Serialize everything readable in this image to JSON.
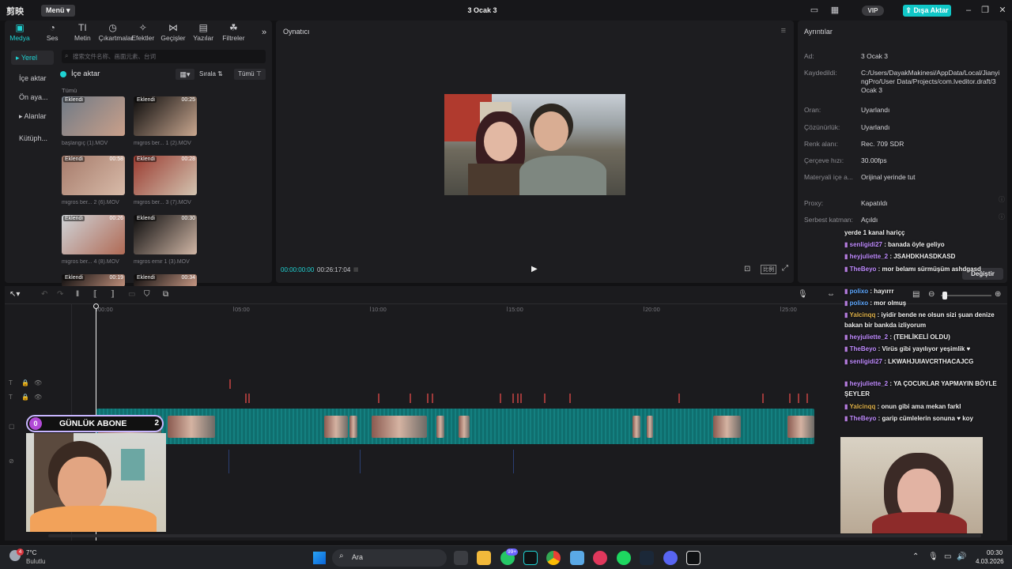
{
  "titlebar": {
    "logo": "剪映",
    "menu_label": "Menü",
    "project_title": "3 Ocak 3",
    "vip_label": "VIP",
    "export_label": "Dışa Aktar"
  },
  "media_toolbar": [
    {
      "label": "Medya",
      "icon": "media-icon",
      "active": true
    },
    {
      "label": "Ses",
      "icon": "audio-icon"
    },
    {
      "label": "Metin",
      "icon": "text-icon"
    },
    {
      "label": "Çıkartmalar",
      "icon": "sticker-icon"
    },
    {
      "label": "Efektler",
      "icon": "effects-icon"
    },
    {
      "label": "Geçişler",
      "icon": "transition-icon"
    },
    {
      "label": "Yazılar",
      "icon": "caption-icon"
    },
    {
      "label": "Filtreler",
      "icon": "filter-icon"
    }
  ],
  "media_sidebar": [
    "Yerel",
    "İçe aktar",
    "Ön aya...",
    "Alanlar",
    "Kütüph..."
  ],
  "media": {
    "search_placeholder": "搜索文件名称、画面元素、台词",
    "import_label": "İçe aktar",
    "sort_label": "Sırala",
    "filter_label": "Tümü",
    "section_label": "Tümü",
    "items": [
      {
        "badge": "Eklendi",
        "duration": "",
        "name": "başlangıç (1).MOV"
      },
      {
        "badge": "Eklendi",
        "duration": "00:25",
        "name": "migros ber... 1 (2).MOV"
      },
      {
        "badge": "Eklendi",
        "duration": "00:58",
        "name": "migros ber... 2 (6).MOV"
      },
      {
        "badge": "Eklendi",
        "duration": "00:28",
        "name": "migros ber... 3 (7).MOV"
      },
      {
        "badge": "Eklendi",
        "duration": "00:26",
        "name": "migros ber... 4 (8).MOV"
      },
      {
        "badge": "Eklendi",
        "duration": "00:30",
        "name": "migros emir 1 (3).MOV"
      },
      {
        "badge": "Eklendi",
        "duration": "00:19",
        "name": ""
      },
      {
        "badge": "Eklendi",
        "duration": "00:34",
        "name": ""
      }
    ]
  },
  "player": {
    "title": "Oynatıcı",
    "current_time": "00:00:00:00",
    "total_time": "00:26:17:04",
    "ratio_label": "比例"
  },
  "details": {
    "title": "Ayrıntılar",
    "rows": [
      {
        "label": "Ad:",
        "value": "3 Ocak 3"
      },
      {
        "label": "Kaydedildi:",
        "value": "C:/Users/DayakMakinesi/AppData/Local/JianyingPro/User Data/Projects/com.lveditor.draft/3 Ocak 3"
      },
      {
        "label": "Oran:",
        "value": "Uyarlandı"
      },
      {
        "label": "Çözünürlük:",
        "value": "Uyarlandı"
      },
      {
        "label": "Renk alanı:",
        "value": "Rec. 709 SDR"
      },
      {
        "label": "Çerçeve hızı:",
        "value": "30.00fps"
      },
      {
        "label": "Materyali içe a...",
        "value": "Orijinal yerinde tut"
      },
      {
        "label": "Proxy:",
        "value": "Kapatıldı"
      },
      {
        "label": "Serbest katman:",
        "value": "Açıldı"
      }
    ],
    "change_button": "Değiştir"
  },
  "timeline": {
    "ruler": [
      "00:00",
      "05:00",
      "10:00",
      "15:00",
      "20:00",
      "25:00"
    ]
  },
  "overlay": {
    "sub_count": "0",
    "sub_label": "GÜNLÜK ABONE",
    "sub_goal": "2"
  },
  "chat": [
    {
      "user": "",
      "text": "yerde 1 kanal hariçç"
    },
    {
      "user": "senligidi27",
      "text": ": banada öyle geliyo"
    },
    {
      "user": "heyjuliette_2",
      "text": ": JSAHDKHASDKASD"
    },
    {
      "user": "TheBeyo",
      "text": ": mor belamı sürmüşüm ashdgasd"
    },
    {
      "user": "polixo",
      "text": ": hayırrr"
    },
    {
      "user": "polixo",
      "text": ": mor olmuş"
    },
    {
      "user": "Yalcinqq",
      "text": ": iyidir bende ne olsun sizi şuan denize bakan bir bankda izliyorum"
    },
    {
      "user": "heyjuliette_2",
      "text": ": (TEHLİKELİ OLDU)"
    },
    {
      "user": "TheBeyo",
      "text": ": Virüs gibi yayılıyor yeşimlik ♥"
    },
    {
      "user": "senligidi27",
      "text": ": LKWAHJUIAVCRTHACAJCG"
    },
    {
      "user": "heyjuliette_2",
      "text": ": YA ÇOCUKLAR YAPMAYIN BÖYLE ŞEYLER"
    },
    {
      "user": "Yalcinqq",
      "text": ": onun gibi ama mekan farkl"
    },
    {
      "user": "TheBeyo",
      "text": ": garip cümlelerin sonuna ♥ koy"
    }
  ],
  "taskbar": {
    "weather_temp": "7°C",
    "weather_desc": "Bulutlu",
    "weather_badge": "4",
    "search_label": "Ara",
    "badge_99": "99+",
    "time": "00:30",
    "date": "4.03.2026"
  }
}
